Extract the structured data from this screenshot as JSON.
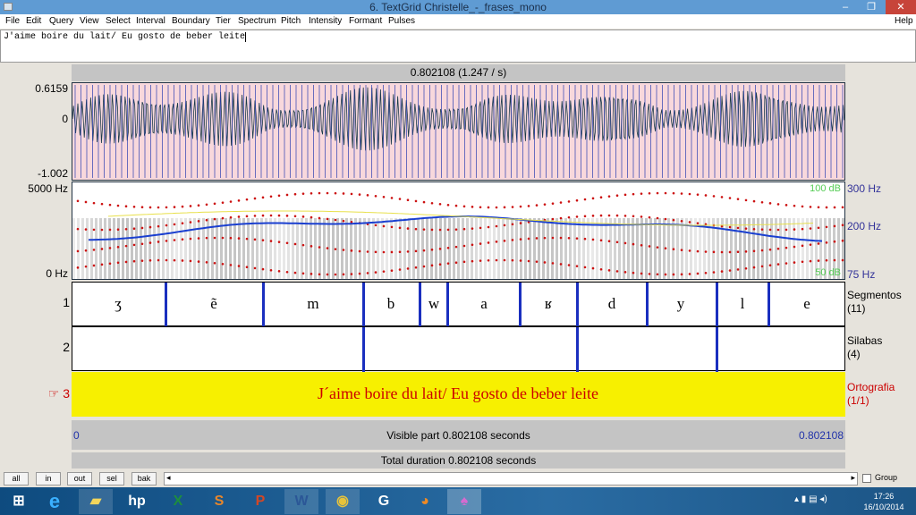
{
  "window": {
    "title": "6. TextGrid Christelle_-_frases_mono",
    "minimize": "–",
    "maximize": "❐",
    "close": "✕"
  },
  "menu": [
    "File",
    "Edit",
    "Query",
    "View",
    "Select",
    "Interval",
    "Boundary",
    "Tier",
    "Spectrum",
    "Pitch",
    "Intensity",
    "Formant",
    "Pulses"
  ],
  "help": "Help",
  "text_field": "J'aime boire du lait/ Eu gosto de beber leite",
  "time_header": "0.802108 (1.247 / s)",
  "waveform": {
    "ymax": "0.6159",
    "yzero": "0",
    "ymin": "-1.002"
  },
  "spectrogram": {
    "fmax": "5000 Hz",
    "fmin": "0 Hz",
    "pitch_top": "300 Hz",
    "pitch_mid": "200 Hz",
    "pitch_bottom": "75 Hz",
    "intensity_top": "100 dB",
    "intensity_bottom": "50 dB",
    "colors": {
      "pitch": "#1a3fd0",
      "formant": "#cc1111",
      "intensity": "#e8e04a"
    }
  },
  "tiers": [
    {
      "number": "1",
      "name": "Segmentos",
      "count": "(11)",
      "segments": [
        "ʒ",
        "ẽ",
        "m",
        "b",
        "w",
        "a",
        "ʁ",
        "d",
        "y",
        "l",
        "e"
      ]
    },
    {
      "number": "2",
      "name": "Silabas",
      "count": "(4)",
      "segments": []
    },
    {
      "number": "3",
      "name": "Ortografia",
      "count": "(1/1)",
      "segments": [
        "J´aime boire du lait/ Eu gosto de beber leite"
      ],
      "selected": true,
      "color": "#f7f000"
    }
  ],
  "visible": {
    "start": "0",
    "label": "Visible part 0.802108 seconds",
    "end": "0.802108"
  },
  "total": "Total duration 0.802108 seconds",
  "buttons": [
    "all",
    "in",
    "out",
    "sel",
    "bak"
  ],
  "group": "Group",
  "taskbar": {
    "apps": [
      "Internet Explorer",
      "File Explorer",
      "HP",
      "Excel",
      "Sway",
      "PowerPoint",
      "Word",
      "Chrome",
      "App",
      "Firefox",
      "Praat"
    ],
    "time": "17:26",
    "date": "16/10/2014"
  }
}
